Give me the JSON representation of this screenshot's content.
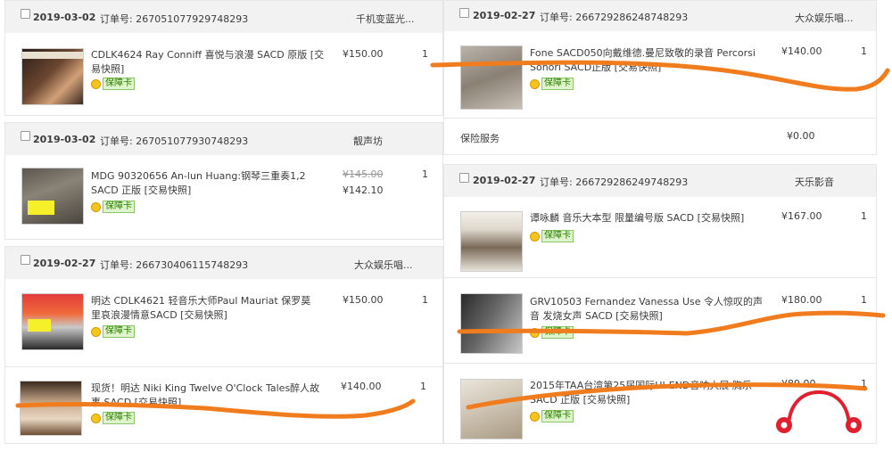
{
  "order_label": "订单号:",
  "badge_label": "保障卡",
  "left": [
    {
      "date": "2019-03-02",
      "order_no": "267051077929748293",
      "seller": "千机变蓝光...",
      "item": {
        "title": "CDLK4624 Ray Conniff 喜悦与浪漫 SACD 原版 [交易快照]",
        "price": "¥150.00",
        "qty": "1"
      }
    },
    {
      "date": "2019-03-02",
      "order_no": "267051077930748293",
      "seller": "靓声坊",
      "item": {
        "title": "MDG 90320656 An-lun Huang:钢琴三重奏1,2 SACD 正版 [交易快照]",
        "orig_price": "¥145.00",
        "price": "¥142.10",
        "qty": "1"
      }
    },
    {
      "date": "2019-02-27",
      "order_no": "266730406115748293",
      "seller": "大众娱乐唱...",
      "items": [
        {
          "title": "明达 CDLK4621 轻音乐大师Paul Mauriat 保罗莫里哀浪漫情意SACD [交易快照]",
          "price": "¥150.00",
          "qty": "1"
        },
        {
          "title": "现货！明达 Niki King Twelve O'Clock Tales醉人故事 SACD [交易快照]",
          "price": "¥140.00",
          "qty": "1"
        }
      ]
    }
  ],
  "right": [
    {
      "date": "2019-02-27",
      "order_no": "266729286248748293",
      "seller": "大众娱乐唱...",
      "item": {
        "title": "Fone SACD050向戴维德.曼尼致敬的录音 Percorsi Sonori SACD正版 [交易快照]",
        "price": "¥140.00",
        "qty": "1"
      },
      "service_label": "保险服务",
      "service_price": "¥0.00"
    },
    {
      "date": "2019-02-27",
      "order_no": "266729286249748293",
      "seller": "天乐影音",
      "items": [
        {
          "title": "谭咏麟 音乐大本型 限量编号版 SACD [交易快照]",
          "price": "¥167.00",
          "qty": "1"
        },
        {
          "title": "GRV10503 Fernandez Vanessa Use 令人惊叹的声音 发烧女声 SACD [交易快照]",
          "price": "¥180.00",
          "qty": "1"
        },
        {
          "title": "2015年TAA台湾第25届国际HI-END音响大展 胸乐 SACD 正版 [交易快照]",
          "price": "¥89.00",
          "qty": "1"
        }
      ]
    }
  ],
  "colors": {
    "header_bg": "#f2f2f2",
    "scribble": "#f07c1e",
    "logo_red": "#e0202f",
    "badge_green": "#2b8a00"
  }
}
